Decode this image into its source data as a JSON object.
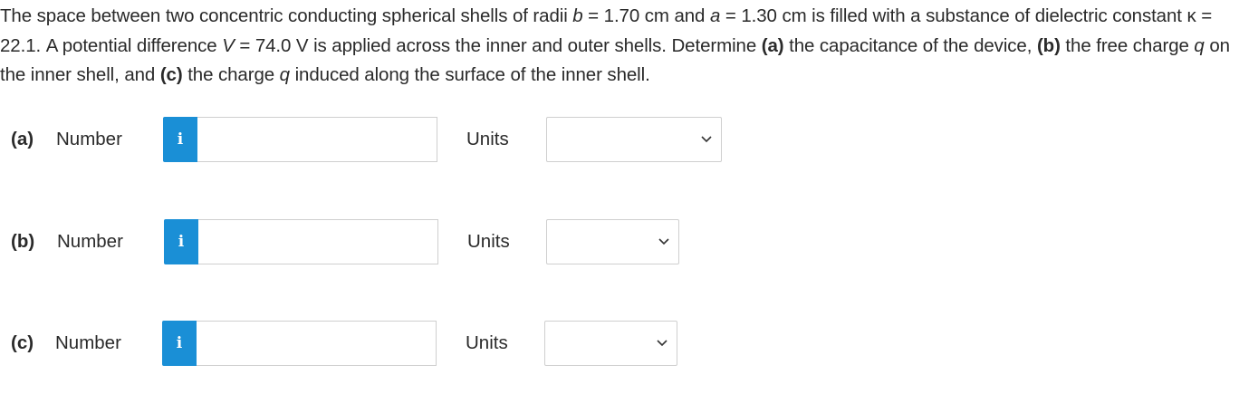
{
  "problem": {
    "t1": "The space between two concentric conducting spherical shells of radii ",
    "var_b": "b",
    "t2": " = 1.70 cm and ",
    "var_a": "a",
    "t3": " = 1.30 cm is filled with a substance of dielectric constant κ = 22.1. A potential difference ",
    "var_V": "V",
    "t4": " = 74.0 V is applied across the inner and outer shells. Determine ",
    "pa": "(a)",
    "t5": " the capacitance of the device, ",
    "pb": "(b)",
    "t6": " the free charge ",
    "var_q1": "q",
    "t7": " on the inner shell, and ",
    "pc": "(c)",
    "t8": " the charge ",
    "var_q2": "q",
    "t9": " induced along the surface of the inner shell."
  },
  "parts": [
    {
      "label": "(a)",
      "number_label": "Number",
      "info_icon": "i",
      "value": "",
      "units_label": "Units",
      "units_selected": ""
    },
    {
      "label": "(b)",
      "number_label": "Number",
      "info_icon": "i",
      "value": "",
      "units_label": "Units",
      "units_selected": ""
    },
    {
      "label": "(c)",
      "number_label": "Number",
      "info_icon": "i",
      "value": "",
      "units_label": "Units",
      "units_selected": ""
    }
  ],
  "icons": {
    "info": "info-icon",
    "dropdown": "chevron-down-icon"
  },
  "colors": {
    "info_button": "#1a8fd6",
    "text": "#2a2a2a",
    "border": "#cfcfcf"
  }
}
